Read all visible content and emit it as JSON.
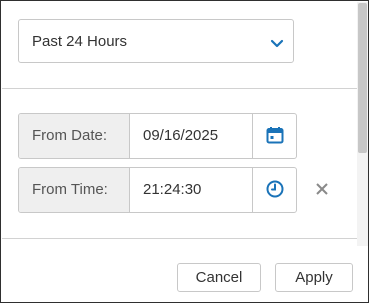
{
  "range": {
    "selected": "Past 24 Hours",
    "icon": "chevron-down-icon"
  },
  "from_date": {
    "label": "From Date:",
    "value": "09/16/2025",
    "icon": "calendar-icon"
  },
  "from_time": {
    "label": "From Time:",
    "value": "21:24:30",
    "icon": "clock-icon",
    "clear_icon": "close-icon"
  },
  "actions": {
    "cancel_label": "Cancel",
    "apply_label": "Apply"
  },
  "colors": {
    "accent": "#1a73b8",
    "border": "#c8c8c8",
    "label_bg": "#efefef"
  }
}
